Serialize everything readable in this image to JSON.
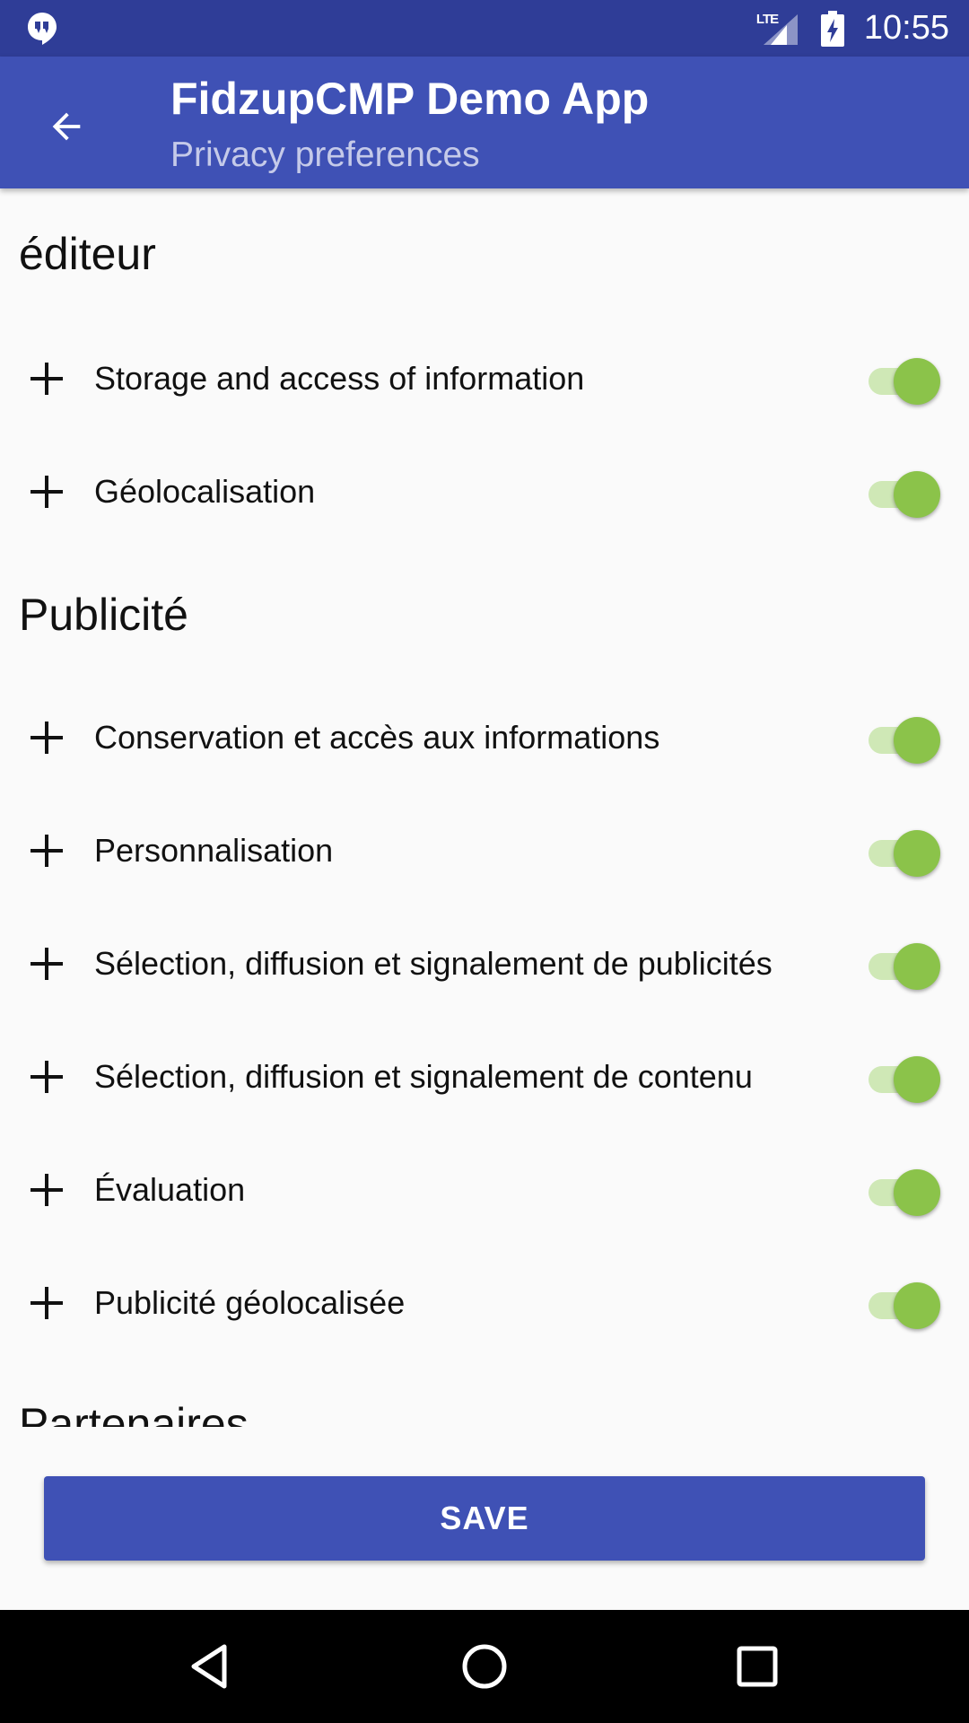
{
  "status_bar": {
    "network_label": "LTE",
    "time": "10:55"
  },
  "app_bar": {
    "title": "FidzupCMP Demo App",
    "subtitle": "Privacy preferences"
  },
  "sections": [
    {
      "title": "éditeur",
      "items": [
        {
          "label": "Storage and access of information",
          "enabled": true
        },
        {
          "label": "Géolocalisation",
          "enabled": true
        }
      ]
    },
    {
      "title": "Publicité",
      "items": [
        {
          "label": "Conservation et accès aux informations",
          "enabled": true
        },
        {
          "label": "Personnalisation",
          "enabled": true
        },
        {
          "label": "Sélection, diffusion et signalement de publicités",
          "enabled": true
        },
        {
          "label": "Sélection, diffusion et signalement de contenu",
          "enabled": true
        },
        {
          "label": "Évaluation",
          "enabled": true
        },
        {
          "label": "Publicité géolocalisée",
          "enabled": true
        }
      ]
    },
    {
      "title": "Partenaires",
      "items": []
    }
  ],
  "save_button": {
    "label": "SAVE"
  },
  "colors": {
    "primary": "#3f51b5",
    "primary_dark": "#2f3d97",
    "switch_on": "#8bc34a"
  },
  "icons": {
    "status_left": "hangouts-icon",
    "signal": "signal-icon",
    "battery": "battery-charging-icon",
    "back": "arrow-back-icon",
    "expand": "plus-icon",
    "nav_back": "triangle-back-icon",
    "nav_home": "circle-home-icon",
    "nav_recents": "square-recents-icon"
  }
}
